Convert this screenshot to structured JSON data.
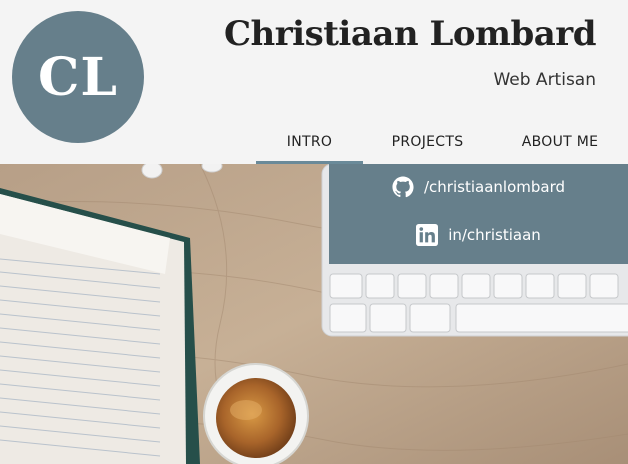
{
  "header": {
    "logo_initials": "CL",
    "name": "Christiaan Lombard",
    "tagline": "Web Artisan"
  },
  "nav": {
    "items": [
      {
        "label": "INTRO",
        "active": true
      },
      {
        "label": "PROJECTS",
        "active": false
      },
      {
        "label": "ABOUT ME",
        "active": false
      }
    ]
  },
  "social": {
    "github": {
      "label": "/christiaanlombard",
      "icon": "github-icon"
    },
    "linkedin": {
      "label": "in/christiaan",
      "icon": "linkedin-icon"
    }
  },
  "colors": {
    "accent": "#667f8b",
    "active_underline": "#6a8a99",
    "header_bg": "#f4f4f4"
  }
}
